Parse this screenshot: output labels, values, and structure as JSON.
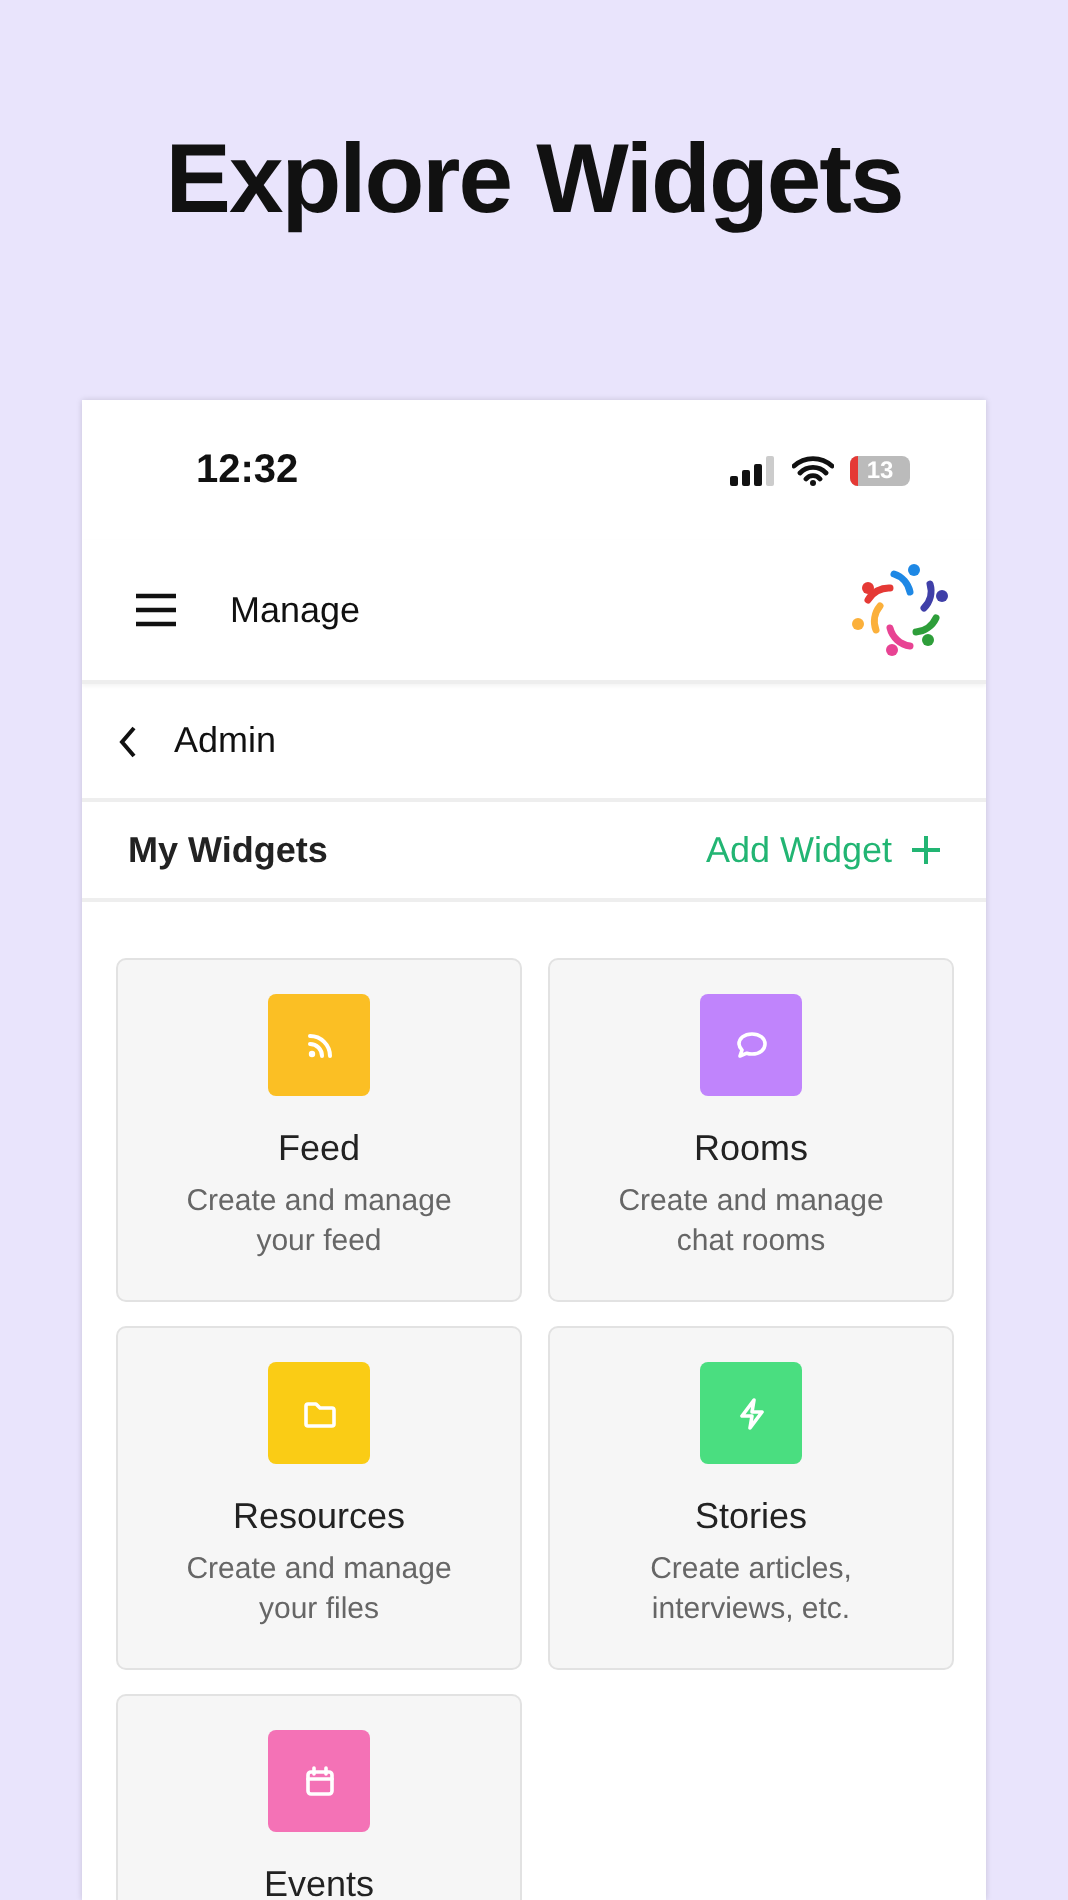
{
  "headline": "Explore Widgets",
  "status_bar": {
    "time": "12:32",
    "battery": "13"
  },
  "header": {
    "title": "Manage"
  },
  "breadcrumb": {
    "title": "Admin"
  },
  "section": {
    "title": "My Widgets",
    "action": "Add Widget"
  },
  "widgets": [
    {
      "kind": "rss",
      "color": "#fbbf24",
      "title": "Feed",
      "description": "Create and manage your feed"
    },
    {
      "kind": "chat",
      "color": "#c084fc",
      "title": "Rooms",
      "description": "Create and manage chat rooms"
    },
    {
      "kind": "folder",
      "color": "#facc15",
      "title": "Resources",
      "description": "Create and manage your files"
    },
    {
      "kind": "bolt",
      "color": "#4ade80",
      "title": "Stories",
      "description": "Create articles, interviews, etc."
    },
    {
      "kind": "calendar",
      "color": "#f472b6",
      "title": "Events"
    }
  ]
}
